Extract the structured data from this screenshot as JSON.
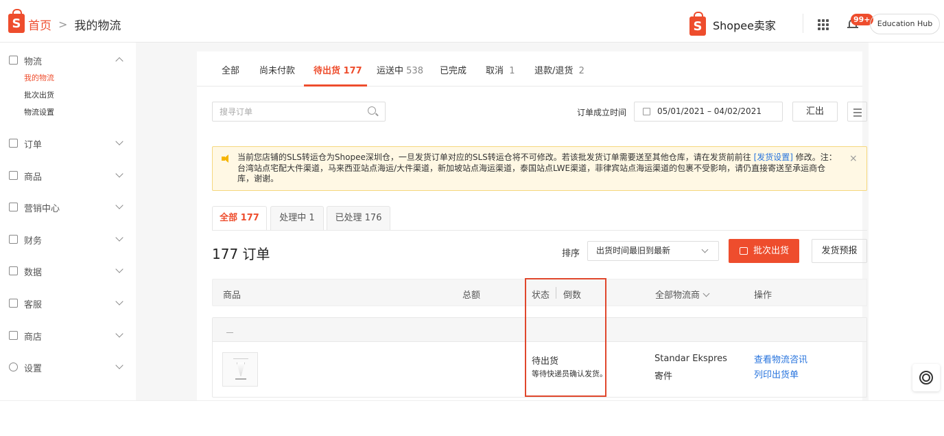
{
  "header": {
    "logo_letter": "S",
    "crumb_home": "首页",
    "crumb_sep": ">",
    "crumb_current": "我的物流",
    "brand": "Shopee卖家",
    "notif_count": "99+",
    "edu_hub": "Education Hub"
  },
  "sidebar": {
    "sections": [
      {
        "label": "物流",
        "icon": "package-icon"
      },
      {
        "label": "订单",
        "icon": "clipboard-icon"
      },
      {
        "label": "商品",
        "icon": "box-icon"
      },
      {
        "label": "营销中心",
        "icon": "tag-icon"
      },
      {
        "label": "财务",
        "icon": "wallet-icon"
      },
      {
        "label": "数据",
        "icon": "chart-icon"
      },
      {
        "label": "客服",
        "icon": "chat-icon"
      },
      {
        "label": "商店",
        "icon": "store-icon"
      },
      {
        "label": "设置",
        "icon": "gear-icon"
      }
    ],
    "logistics_sub": [
      "我的物流",
      "批次出货",
      "物流设置"
    ]
  },
  "tabs": [
    {
      "label": "全部",
      "count": ""
    },
    {
      "label": "尚未付款",
      "count": ""
    },
    {
      "label": "待出货",
      "count": "177"
    },
    {
      "label": "运送中",
      "count": "538"
    },
    {
      "label": "已完成",
      "count": ""
    },
    {
      "label": "取消",
      "count": "1"
    },
    {
      "label": "退款/退货",
      "count": "2"
    }
  ],
  "toolbar": {
    "search_placeholder": "搜寻订单",
    "date_label": "订单成立时间",
    "date_range": "05/01/2021 – 04/02/2021",
    "export_label": "汇出"
  },
  "notice": {
    "text_before": "当前您店铺的SLS转运仓为Shopee深圳仓，一旦发货订单对应的SLS转运仓将不可修改。若该批发货订单需要送至其他仓库，请在发货前前往 ",
    "link": "[发货设置]",
    "text_after": " 修改。注：台湾站点宅配大件渠道，马来西亚站点海运/大件渠道，新加坡站点海运渠道，泰国站点LWE渠道，菲律宾站点海运渠道的包裹不受影响，请仍直接寄送至承运商仓库，谢谢。",
    "close": "×"
  },
  "subtabs": [
    {
      "label": "全部 177"
    },
    {
      "label": "处理中 1"
    },
    {
      "label": "已处理 176"
    }
  ],
  "orders": {
    "title": "177 订单",
    "sort_label": "排序",
    "sort_value": "出货时间最旧到最新",
    "batch_label": "批次出货",
    "preview_label": "发货预报"
  },
  "table": {
    "headers": {
      "product": "商品",
      "total": "总额",
      "status": "状态",
      "countdown": "倒数",
      "carrier": "全部物流商",
      "action": "操作"
    }
  },
  "order_row": {
    "head_dash": "—",
    "status": "待出货",
    "status_sub": "等待快递员确认发货。",
    "carrier": "Standar Ekspres",
    "carrier_sub": "寄件",
    "action_1": "查看物流咨讯",
    "action_2": "列印出货单"
  }
}
